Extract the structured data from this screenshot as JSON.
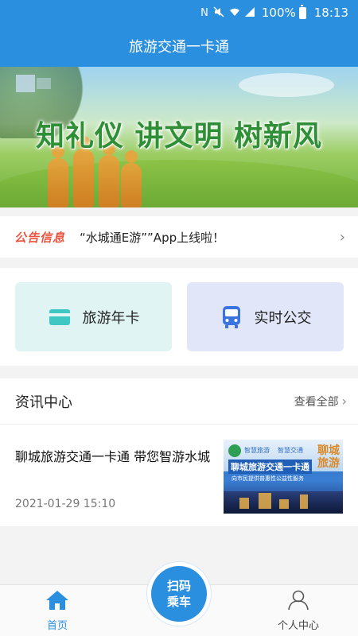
{
  "status_bar": {
    "icons": [
      "nfc-icon",
      "mute-icon",
      "wifi-icon",
      "signal-icon"
    ],
    "battery": "100%",
    "time": "18:13"
  },
  "header": {
    "title": "旅游交通一卡通"
  },
  "banner": {
    "slogan": "知礼仪 讲文明 树新风"
  },
  "notice": {
    "tag": "公告信息",
    "text": "“水城通E游””App上线啦！"
  },
  "quick_actions": [
    {
      "label": "旅游年卡",
      "icon": "card-icon"
    },
    {
      "label": "实时公交",
      "icon": "bus-icon"
    }
  ],
  "news": {
    "title": "资讯中心",
    "more_label": "查看全部",
    "items": [
      {
        "title": "聊城旅游交通一卡通 带您智游水城",
        "date": "2021-01-29 15:10",
        "thumb": {
          "small_left": "智慧旅游",
          "small_right": "智慧交通",
          "main": "聊城旅游交通一卡通",
          "sub": "向市民提供普惠性公益性服务",
          "side": "聊城旅游"
        }
      }
    ]
  },
  "bottom_nav": {
    "home_label": "首页",
    "scan_line1": "扫码",
    "scan_line2": "乘车",
    "profile_label": "个人中心"
  },
  "colors": {
    "primary": "#2b8fe0",
    "notice_tag": "#e8553f",
    "slogan": "#2e8f37"
  }
}
